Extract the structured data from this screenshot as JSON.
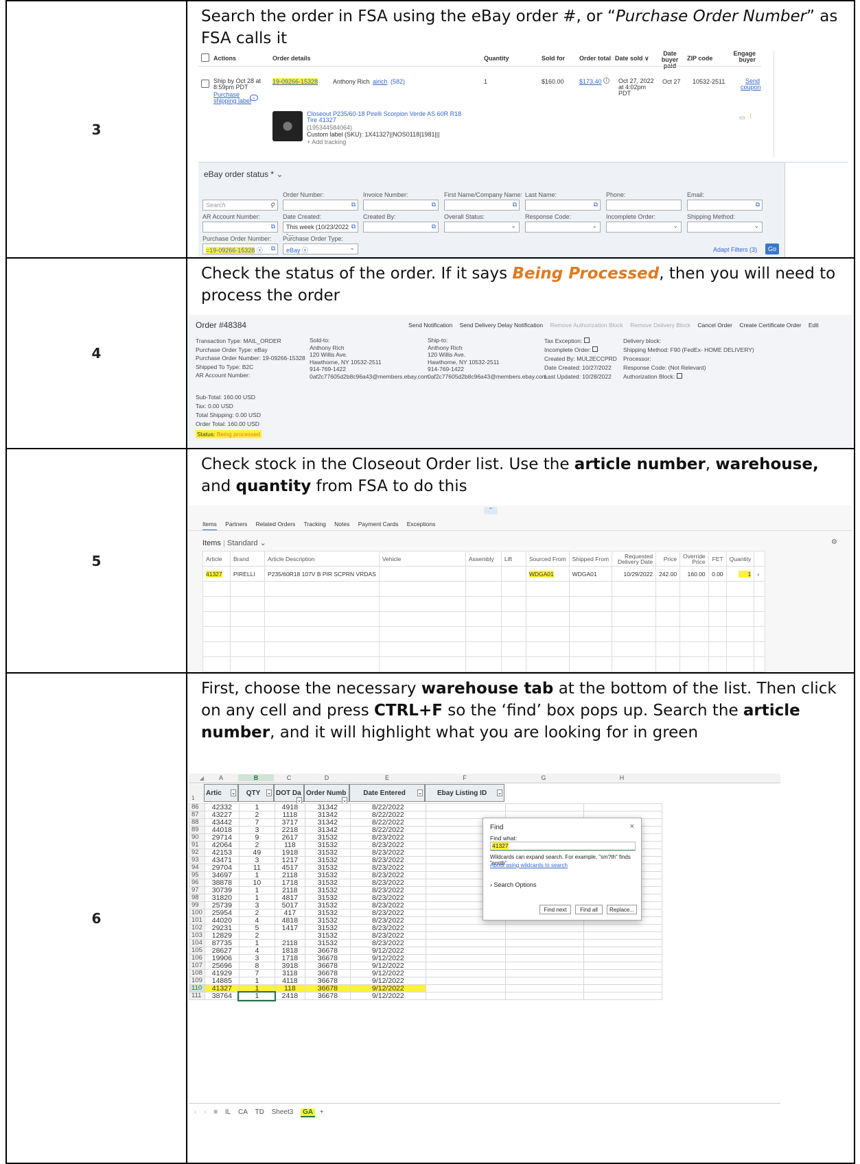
{
  "rows": [
    {
      "number": "3",
      "instruction_a": "Search the order in FSA using the eBay order #, or “",
      "instruction_italic": "Purchase Order Number",
      "instruction_b": "” as FSA calls it"
    },
    {
      "number": "4",
      "instruction_a": "Check the status of the order. If it says ",
      "instruction_status": "Being Processed",
      "instruction_b": ", then you will need to process the order"
    },
    {
      "number": "5",
      "instruction_a": "Check stock in the Closeout Order list. Use the ",
      "bold1": "article number",
      "sep1": ", ",
      "bold2": "warehouse,",
      "sep2": " and ",
      "bold3": "quantity",
      "instruction_b": " from FSA to do this"
    },
    {
      "number": "6",
      "t1": "First, choose the necessary ",
      "b1": "warehouse tab",
      "t2": " at the bottom of the list. Then click on any cell and press ",
      "b2": "CTRL+F",
      "t3": " so the ‘find’ box pops up. Search the ",
      "b3": "article number",
      "t4": ", and it will highlight what you are looking for in green"
    }
  ],
  "ebay": {
    "headers": {
      "actions": "Actions",
      "order_details": "Order details",
      "quantity": "Quantity",
      "sold_for": "Sold for",
      "order_total": "Order total",
      "date_sold": "Date sold ∨",
      "date_paid": "Date buyer paid",
      "zip": "ZIP code",
      "engage": "Engage buyer"
    },
    "ship_by": "Ship by Oct 28 at 8:59pm PDT",
    "purchase_label": "Purchase shipping label",
    "order_no": "19-09266-15328",
    "buyer": "Anthony Rich",
    "buyer_id": "airich",
    "feedback": "(582)",
    "qty": "1",
    "sold_for": "$160.00",
    "order_total": "$173.40",
    "date_sold": "Oct 27, 2022 at 4:02pm PDT",
    "date_paid": "Oct 27",
    "zip": "10532-2511",
    "send_coupon": "Send coupon",
    "item_title": "Closeout P235/60-18 Pirelli Scorpion Verde AS 60R R18 Tire 41327",
    "item_id": "(195344584064)",
    "custom_label": "Custom label (SKU): 1X41327||NOS0118|1981|||",
    "add_tracking": "+ Add tracking"
  },
  "fsa_search": {
    "title": "eBay order status *",
    "labels": {
      "order_number": "Order Number:",
      "invoice_number": "Invoice Number:",
      "first_name": "First Name/Company Name:",
      "last_name": "Last Name:",
      "phone": "Phone:",
      "email": "Email:",
      "ar_account": "AR Account Number:",
      "date_created": "Date Created:",
      "created_by": "Created By:",
      "overall_status": "Overall Status:",
      "response_code": "Response Code:",
      "incomplete_order": "Incomplete Order:",
      "shipping_method": "Shipping Method:",
      "po_number": "Purchase Order Number:",
      "po_type": "Purchase Order Type:"
    },
    "search_placeholder": "Search",
    "date_created_value": "This week (10/23/2022 -...",
    "po_number_value": "=19-09266-15328",
    "po_type_value": "eBay",
    "adapt_filters": "Adapt Filters (3)",
    "go": "Go"
  },
  "order": {
    "title": "Order #48384",
    "actions": [
      "Send Notification",
      "Send Delivery Delay Notification",
      "Remove Authorization Block",
      "Remove Delivery Block",
      "Cancel Order",
      "Create Certificate Order",
      "Edit"
    ],
    "col1": [
      "Transaction Type:  MAIL_ORDER",
      "Purchase Order Type:  eBay",
      "Purchase Order Number:  19-09266-15328",
      "Shipped To Type:  B2C",
      "AR Account Number:"
    ],
    "sold_to_label": "Sold-to:",
    "sold_to": [
      "Anthony Rich",
      "120 Willis Ave.",
      "Hawthorne, NY 10532-2511",
      "914-769-1422",
      "0af2c77605d2b8c96a43@members.ebay.com"
    ],
    "ship_to_label": "Ship-to:",
    "ship_to": [
      "Anthony Rich",
      "120 Willis Ave.",
      "Hawthorne, NY 10532-2511",
      "914-769-1422",
      "0af2c77605d2b8c96a43@members.ebay.com"
    ],
    "col4": [
      "Tax Exception:",
      "Incomplete Order:",
      "Created By:  MUL2ECCPRD",
      "Date Created:  10/27/2022",
      "Last Updated:  10/28/2022"
    ],
    "col5": [
      "Delivery block:",
      "Shipping Method:  F90 (FedEx- HOME DELIVERY)",
      "Processor:",
      "Response Code:  (Not Relevant)",
      "Authorization Block:"
    ],
    "totals": [
      "Sub-Total:  160.00 USD",
      "Tax:  0.00 USD",
      "Total Shipping:  0.00 USD",
      "Order Total:  160.00 USD"
    ],
    "status_label": "Status:",
    "status_value": "Being processed"
  },
  "items_panel": {
    "tabs": [
      "Items",
      "Partners",
      "Related Orders",
      "Tracking",
      "Notes",
      "Payment Cards",
      "Exceptions"
    ],
    "heading": "Items",
    "view": "Standard",
    "columns": [
      "Article",
      "Brand",
      "Article Description",
      "Vehicle",
      "Assembly",
      "Lift",
      "Sourced From",
      "Shipped From",
      "Requested Delivery Date",
      "Price",
      "Override Price",
      "FET",
      "Quantity"
    ],
    "row": [
      "41327",
      "PIRELLI",
      "P235/60R18 107V B PIR SCPRN VRDAS",
      "",
      "",
      "",
      "WDGA01",
      "WDGA01",
      "10/29/2022",
      "242.00",
      "160.00",
      "0.00",
      "1"
    ]
  },
  "excel": {
    "col_letters": [
      "A",
      "B",
      "C",
      "D",
      "E",
      "F",
      "G",
      "H"
    ],
    "headers": [
      "Artic",
      "QTY",
      "DOT Da",
      "Order Numb",
      "Date Entered",
      "Ebay Listing ID"
    ],
    "rows": [
      [
        "86",
        "42332",
        "1",
        "4918",
        "31342",
        "8/22/2022"
      ],
      [
        "87",
        "43227",
        "2",
        "1118",
        "31342",
        "8/22/2022"
      ],
      [
        "88",
        "43442",
        "7",
        "3717",
        "31342",
        "8/22/2022"
      ],
      [
        "89",
        "44018",
        "3",
        "2218",
        "31342",
        "8/22/2022"
      ],
      [
        "90",
        "29714",
        "9",
        "2617",
        "31532",
        "8/23/2022"
      ],
      [
        "91",
        "42064",
        "2",
        "118",
        "31532",
        "8/23/2022"
      ],
      [
        "92",
        "42153",
        "49",
        "1918",
        "31532",
        "8/23/2022"
      ],
      [
        "93",
        "43471",
        "3",
        "1217",
        "31532",
        "8/23/2022"
      ],
      [
        "94",
        "29704",
        "11",
        "4517",
        "31532",
        "8/23/2022"
      ],
      [
        "95",
        "34697",
        "1",
        "2118",
        "31532",
        "8/23/2022"
      ],
      [
        "96",
        "38878",
        "10",
        "1718",
        "31532",
        "8/23/2022"
      ],
      [
        "97",
        "30739",
        "1",
        "2118",
        "31532",
        "8/23/2022"
      ],
      [
        "98",
        "31820",
        "1",
        "4817",
        "31532",
        "8/23/2022"
      ],
      [
        "99",
        "25739",
        "3",
        "5017",
        "31532",
        "8/23/2022"
      ],
      [
        "100",
        "25954",
        "2",
        "417",
        "31532",
        "8/23/2022"
      ],
      [
        "101",
        "44020",
        "4",
        "4818",
        "31532",
        "8/23/2022"
      ],
      [
        "102",
        "29231",
        "5",
        "1417",
        "31532",
        "8/23/2022"
      ],
      [
        "103",
        "12829",
        "2",
        "",
        "31532",
        "8/23/2022"
      ],
      [
        "104",
        "87735",
        "1",
        "2118",
        "31532",
        "8/23/2022"
      ],
      [
        "105",
        "28627",
        "4",
        "1818",
        "36678",
        "9/12/2022"
      ],
      [
        "106",
        "19906",
        "3",
        "1718",
        "36678",
        "9/12/2022"
      ],
      [
        "107",
        "25696",
        "8",
        "3918",
        "36678",
        "9/12/2022"
      ],
      [
        "108",
        "41929",
        "7",
        "3118",
        "36678",
        "9/12/2022"
      ],
      [
        "109",
        "14885",
        "1",
        "4118",
        "36678",
        "9/12/2022"
      ],
      [
        "110",
        "41327",
        "1",
        "118",
        "36678",
        "9/12/2022"
      ],
      [
        "111",
        "38764",
        "1",
        "2418",
        "36678",
        "9/12/2022"
      ]
    ],
    "sheet_tabs": [
      "IL",
      "CA",
      "TD",
      "Sheet3",
      "GA"
    ],
    "find": {
      "title": "Find",
      "find_what": "Find what:",
      "value": "41327",
      "hint": "Wildcards can expand search. For example, \"sm?th\" finds \"smith\".",
      "link": "About using wildcards to search",
      "options": "Search Options",
      "find_next": "Find next",
      "find_all": "Find all",
      "replace": "Replace..."
    }
  },
  "colors": {
    "highlight": "#fff23a",
    "ebay_link": "#3366cc",
    "status_orange": "#e07a1f",
    "excel_select_green": "#217346"
  }
}
